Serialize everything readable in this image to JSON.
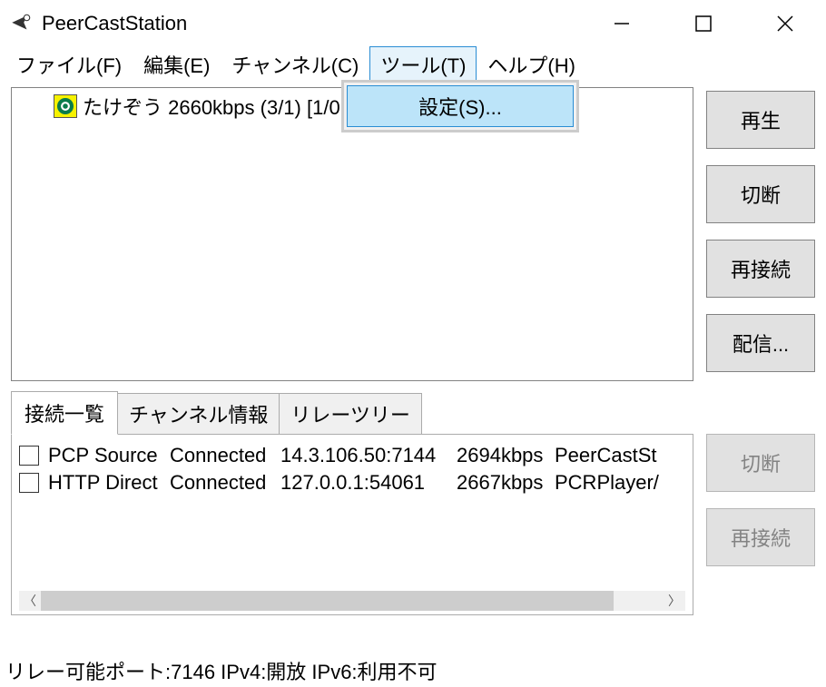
{
  "title": "PeerCastStation",
  "menu": {
    "file": "ファイル(F)",
    "edit": "編集(E)",
    "channel": "チャンネル(C)",
    "tools": "ツール(T)",
    "help": "ヘルプ(H)"
  },
  "tools_dropdown": {
    "settings": "設定(S)..."
  },
  "channels": [
    {
      "text": "たけぞう 2660kbps (3/1) [1/0"
    }
  ],
  "buttons": {
    "play": "再生",
    "disconnect": "切断",
    "reconnect": "再接続",
    "broadcast": "配信..."
  },
  "tabs": {
    "connections": "接続一覧",
    "channel_info": "チャンネル情報",
    "relay_tree": "リレーツリー"
  },
  "connections": [
    {
      "proto": "PCP Source",
      "state": "Connected",
      "addr": "14.3.106.50:7144",
      "bw": "2694kbps",
      "agent": "PeerCastSt"
    },
    {
      "proto": "HTTP Direct",
      "state": "Connected",
      "addr": "127.0.0.1:54061",
      "bw": "2667kbps",
      "agent": "PCRPlayer/"
    }
  ],
  "conn_buttons": {
    "disconnect": "切断",
    "reconnect": "再接続"
  },
  "status": "リレー可能ポート:7146 IPv4:開放 IPv6:利用不可"
}
